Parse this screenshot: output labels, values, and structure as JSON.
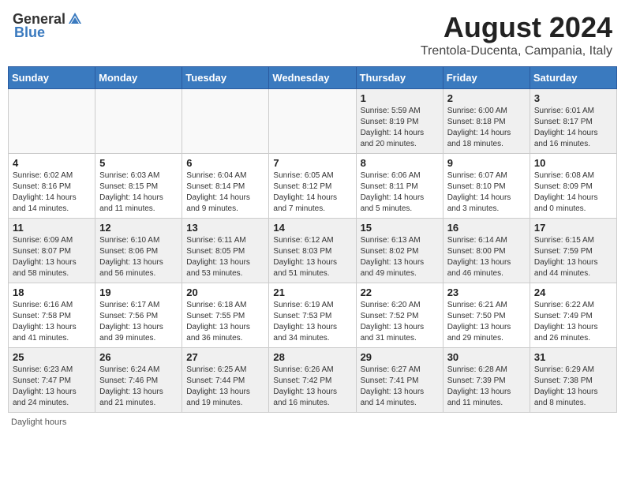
{
  "header": {
    "logo_general": "General",
    "logo_blue": "Blue",
    "main_title": "August 2024",
    "subtitle": "Trentola-Ducenta, Campania, Italy"
  },
  "days_of_week": [
    "Sunday",
    "Monday",
    "Tuesday",
    "Wednesday",
    "Thursday",
    "Friday",
    "Saturday"
  ],
  "footer": {
    "daylight_label": "Daylight hours"
  },
  "weeks": [
    {
      "days": [
        {
          "number": "",
          "info": ""
        },
        {
          "number": "",
          "info": ""
        },
        {
          "number": "",
          "info": ""
        },
        {
          "number": "",
          "info": ""
        },
        {
          "number": "1",
          "info": "Sunrise: 5:59 AM\nSunset: 8:19 PM\nDaylight: 14 hours and 20 minutes."
        },
        {
          "number": "2",
          "info": "Sunrise: 6:00 AM\nSunset: 8:18 PM\nDaylight: 14 hours and 18 minutes."
        },
        {
          "number": "3",
          "info": "Sunrise: 6:01 AM\nSunset: 8:17 PM\nDaylight: 14 hours and 16 minutes."
        }
      ]
    },
    {
      "days": [
        {
          "number": "4",
          "info": "Sunrise: 6:02 AM\nSunset: 8:16 PM\nDaylight: 14 hours and 14 minutes."
        },
        {
          "number": "5",
          "info": "Sunrise: 6:03 AM\nSunset: 8:15 PM\nDaylight: 14 hours and 11 minutes."
        },
        {
          "number": "6",
          "info": "Sunrise: 6:04 AM\nSunset: 8:14 PM\nDaylight: 14 hours and 9 minutes."
        },
        {
          "number": "7",
          "info": "Sunrise: 6:05 AM\nSunset: 8:12 PM\nDaylight: 14 hours and 7 minutes."
        },
        {
          "number": "8",
          "info": "Sunrise: 6:06 AM\nSunset: 8:11 PM\nDaylight: 14 hours and 5 minutes."
        },
        {
          "number": "9",
          "info": "Sunrise: 6:07 AM\nSunset: 8:10 PM\nDaylight: 14 hours and 3 minutes."
        },
        {
          "number": "10",
          "info": "Sunrise: 6:08 AM\nSunset: 8:09 PM\nDaylight: 14 hours and 0 minutes."
        }
      ]
    },
    {
      "days": [
        {
          "number": "11",
          "info": "Sunrise: 6:09 AM\nSunset: 8:07 PM\nDaylight: 13 hours and 58 minutes."
        },
        {
          "number": "12",
          "info": "Sunrise: 6:10 AM\nSunset: 8:06 PM\nDaylight: 13 hours and 56 minutes."
        },
        {
          "number": "13",
          "info": "Sunrise: 6:11 AM\nSunset: 8:05 PM\nDaylight: 13 hours and 53 minutes."
        },
        {
          "number": "14",
          "info": "Sunrise: 6:12 AM\nSunset: 8:03 PM\nDaylight: 13 hours and 51 minutes."
        },
        {
          "number": "15",
          "info": "Sunrise: 6:13 AM\nSunset: 8:02 PM\nDaylight: 13 hours and 49 minutes."
        },
        {
          "number": "16",
          "info": "Sunrise: 6:14 AM\nSunset: 8:00 PM\nDaylight: 13 hours and 46 minutes."
        },
        {
          "number": "17",
          "info": "Sunrise: 6:15 AM\nSunset: 7:59 PM\nDaylight: 13 hours and 44 minutes."
        }
      ]
    },
    {
      "days": [
        {
          "number": "18",
          "info": "Sunrise: 6:16 AM\nSunset: 7:58 PM\nDaylight: 13 hours and 41 minutes."
        },
        {
          "number": "19",
          "info": "Sunrise: 6:17 AM\nSunset: 7:56 PM\nDaylight: 13 hours and 39 minutes."
        },
        {
          "number": "20",
          "info": "Sunrise: 6:18 AM\nSunset: 7:55 PM\nDaylight: 13 hours and 36 minutes."
        },
        {
          "number": "21",
          "info": "Sunrise: 6:19 AM\nSunset: 7:53 PM\nDaylight: 13 hours and 34 minutes."
        },
        {
          "number": "22",
          "info": "Sunrise: 6:20 AM\nSunset: 7:52 PM\nDaylight: 13 hours and 31 minutes."
        },
        {
          "number": "23",
          "info": "Sunrise: 6:21 AM\nSunset: 7:50 PM\nDaylight: 13 hours and 29 minutes."
        },
        {
          "number": "24",
          "info": "Sunrise: 6:22 AM\nSunset: 7:49 PM\nDaylight: 13 hours and 26 minutes."
        }
      ]
    },
    {
      "days": [
        {
          "number": "25",
          "info": "Sunrise: 6:23 AM\nSunset: 7:47 PM\nDaylight: 13 hours and 24 minutes."
        },
        {
          "number": "26",
          "info": "Sunrise: 6:24 AM\nSunset: 7:46 PM\nDaylight: 13 hours and 21 minutes."
        },
        {
          "number": "27",
          "info": "Sunrise: 6:25 AM\nSunset: 7:44 PM\nDaylight: 13 hours and 19 minutes."
        },
        {
          "number": "28",
          "info": "Sunrise: 6:26 AM\nSunset: 7:42 PM\nDaylight: 13 hours and 16 minutes."
        },
        {
          "number": "29",
          "info": "Sunrise: 6:27 AM\nSunset: 7:41 PM\nDaylight: 13 hours and 14 minutes."
        },
        {
          "number": "30",
          "info": "Sunrise: 6:28 AM\nSunset: 7:39 PM\nDaylight: 13 hours and 11 minutes."
        },
        {
          "number": "31",
          "info": "Sunrise: 6:29 AM\nSunset: 7:38 PM\nDaylight: 13 hours and 8 minutes."
        }
      ]
    }
  ]
}
